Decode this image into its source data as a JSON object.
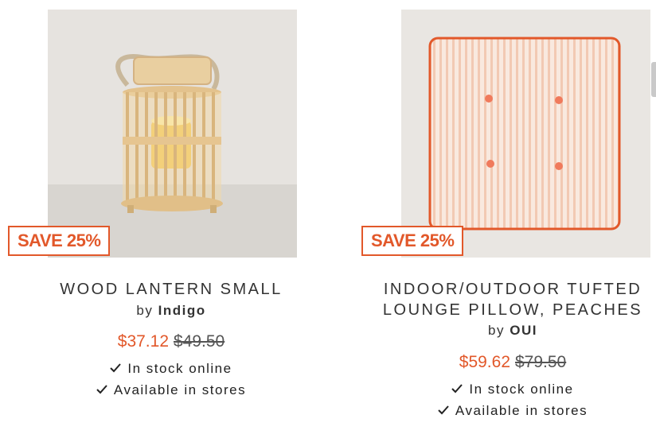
{
  "products": [
    {
      "badge": "SAVE 25%",
      "title_lines": [
        "WOOD LANTERN SMALL"
      ],
      "brand_prefix": "by",
      "brand": "Indigo",
      "sale_price": "$37.12",
      "original_price": "$49.50",
      "availability": [
        "In stock online",
        "Available in stores"
      ]
    },
    {
      "badge": "SAVE 25%",
      "title_lines": [
        "INDOOR/OUTDOOR TUFTED",
        "LOUNGE PILLOW, PEACHES"
      ],
      "brand_prefix": "by",
      "brand": "OUI",
      "sale_price": "$59.62",
      "original_price": "$79.50",
      "availability": [
        "In stock online",
        "Available in stores"
      ]
    }
  ],
  "colors": {
    "accent": "#e2582a",
    "text": "#333333",
    "image_background": "#e3e0dc"
  },
  "icons": {
    "availability": "check-icon"
  }
}
